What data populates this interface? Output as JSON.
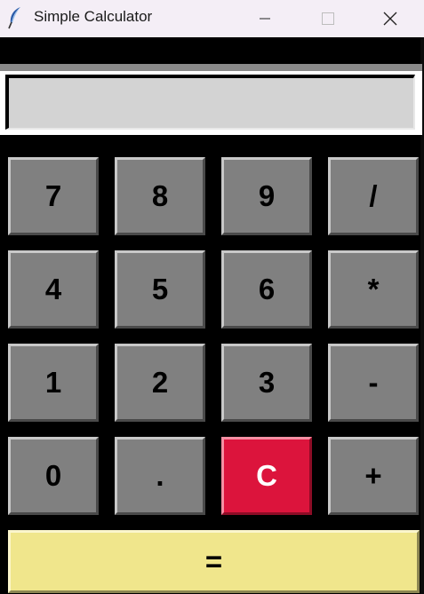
{
  "window": {
    "title": "Simple Calculator",
    "controls": [
      "minimize",
      "maximize",
      "close"
    ]
  },
  "display": {
    "value": ""
  },
  "keypad": {
    "rows": [
      [
        "7",
        "8",
        "9",
        "/"
      ],
      [
        "4",
        "5",
        "6",
        "*"
      ],
      [
        "1",
        "2",
        "3",
        "-"
      ],
      [
        "0",
        ".",
        "C",
        "+"
      ]
    ],
    "equals": "="
  },
  "colors": {
    "background": "#000000",
    "key_face": "#808080",
    "clear_key": "#dc143c",
    "equals_key": "#f0e68c",
    "display_bg": "#d3d3d3",
    "titlebar_bg": "#f4eef6"
  }
}
